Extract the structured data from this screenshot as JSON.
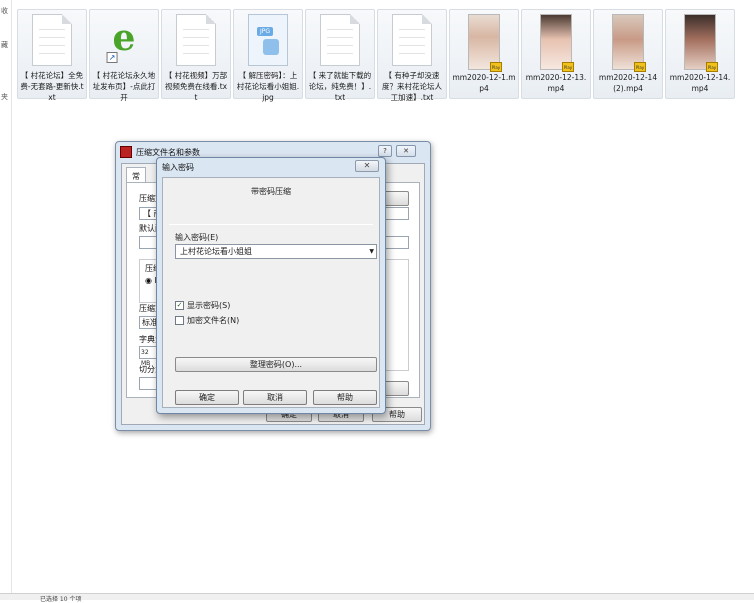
{
  "leftnav": [
    "收",
    "藏",
    "夹",
    "",
    "",
    "",
    "",
    "",
    "",
    "",
    "",
    "",
    ""
  ],
  "files": [
    {
      "name": "【 村花论坛】全免费-无套路-更新快.txt",
      "kind": "txt"
    },
    {
      "name": "【 村花论坛永久地址发布页】-点此打开",
      "kind": "ie"
    },
    {
      "name": "【 村花视频】万部视频免费在线看.txt",
      "kind": "txt"
    },
    {
      "name": "【 解压密码】：上村花论坛看小姐姐.jpg",
      "kind": "jpg"
    },
    {
      "name": "【 来了就能下载的论坛，纯免费！】.txt",
      "kind": "txt"
    },
    {
      "name": "【 有种子却没速度？来村花论坛人工加速】.txt",
      "kind": "txt"
    },
    {
      "name": "mm2020-12-1.mp4",
      "kind": "video"
    },
    {
      "name": "mm2020-12-13.mp4",
      "kind": "video"
    },
    {
      "name": "mm2020-12-14(2).mp4",
      "kind": "video"
    },
    {
      "name": "mm2020-12-14.mp4",
      "kind": "video"
    }
  ],
  "ie_glyph": "e",
  "jpg_tag": "JPG",
  "video_badge": "Play",
  "statusbar": "已选择 10 个项",
  "main_dialog": {
    "title": "压缩文件名和参数",
    "help_glyph": "?",
    "close_glyph": "✕",
    "tab_general": "常规",
    "label_archive": "压缩文",
    "field_archive": "【 商",
    "label_default": "默认配",
    "label_format": "压缩",
    "radio_glyph": "◉ R",
    "label_method": "压缩方",
    "field_method": "标准",
    "label_dict": "字典大",
    "field_dict": "32 MB",
    "label_split": "切分为",
    "browse_btn": "...",
    "ok_btn": "确定",
    "cancel_btn": "取消",
    "help_btn": "帮助"
  },
  "password_dialog": {
    "title": "输入密码",
    "close_glyph": "✕",
    "heading": "带密码压缩",
    "password_label": "输入密码(E)",
    "password_value": "上村花论坛看小姐姐",
    "show_password_label": "显示密码(S)",
    "show_password_checked": true,
    "encrypt_names_label": "加密文件名(N)",
    "encrypt_names_checked": false,
    "check_mark": "✓",
    "manage_btn": "整理密码(O)...",
    "ok_btn": "确定",
    "cancel_btn": "取消",
    "help_btn": "帮助"
  }
}
